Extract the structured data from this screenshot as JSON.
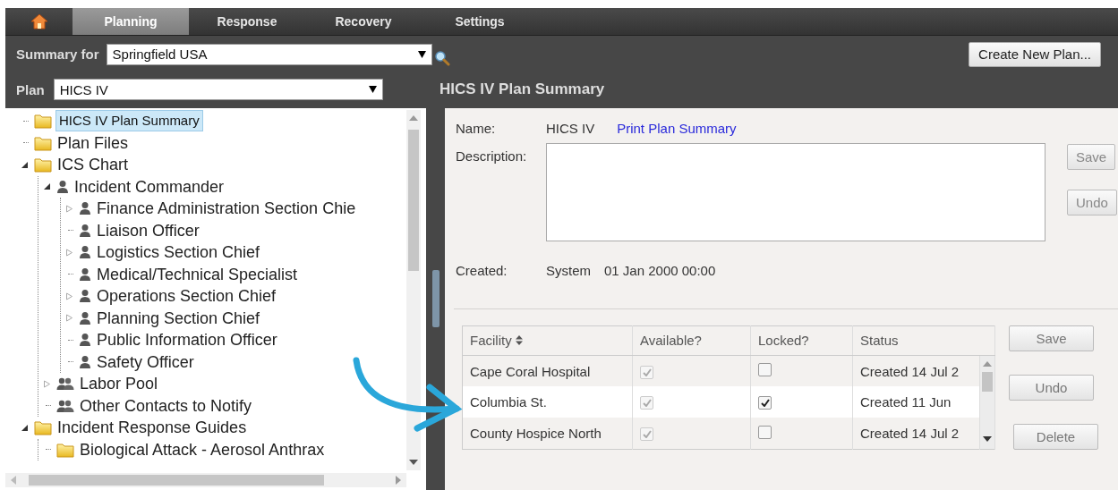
{
  "nav": {
    "tabs": [
      {
        "label": "Planning",
        "selected": true
      },
      {
        "label": "Response",
        "selected": false
      },
      {
        "label": "Recovery",
        "selected": false
      },
      {
        "label": "Settings",
        "selected": false
      }
    ]
  },
  "summary_for": {
    "label": "Summary for",
    "value": "Springfield USA"
  },
  "create_button": "Create New Plan...",
  "plan": {
    "label": "Plan",
    "value": "HICS IV"
  },
  "tree": {
    "items": [
      {
        "label": "HICS IV Plan Summary",
        "kind": "folder",
        "selected": true
      },
      {
        "label": "Plan Files",
        "kind": "folder",
        "selected": false
      },
      {
        "label": "ICS Chart",
        "kind": "folder",
        "selected": false,
        "expanded": true,
        "children": [
          {
            "label": "Incident Commander",
            "kind": "person",
            "selected": false,
            "expanded": true,
            "children": [
              {
                "label": "Finance Administration Section Chie",
                "kind": "person",
                "selected": false,
                "expanded": false
              },
              {
                "label": "Liaison Officer",
                "kind": "person",
                "selected": false
              },
              {
                "label": "Logistics Section Chief",
                "kind": "person",
                "selected": false,
                "expanded": false
              },
              {
                "label": "Medical/Technical Specialist",
                "kind": "person",
                "selected": false
              },
              {
                "label": "Operations Section Chief",
                "kind": "person",
                "selected": false,
                "expanded": false
              },
              {
                "label": "Planning Section Chief",
                "kind": "person",
                "selected": false,
                "expanded": false
              },
              {
                "label": "Public Information Officer",
                "kind": "person",
                "selected": false
              },
              {
                "label": "Safety Officer",
                "kind": "person",
                "selected": false
              }
            ]
          },
          {
            "label": "Labor Pool",
            "kind": "group",
            "selected": false,
            "expanded": false
          },
          {
            "label": "Other Contacts to Notify",
            "kind": "group",
            "selected": false
          }
        ]
      },
      {
        "label": "Incident Response Guides",
        "kind": "folder",
        "selected": false,
        "expanded": true,
        "children": [
          {
            "label": "Biological Attack - Aerosol Anthrax",
            "kind": "folder",
            "selected": false
          }
        ]
      }
    ]
  },
  "panel": {
    "title": "HICS IV Plan Summary",
    "name_label": "Name:",
    "name_value": "HICS IV",
    "print_link": "Print Plan Summary",
    "description_label": "Description:",
    "description_buttons": [
      "Save",
      "Undo"
    ],
    "created_label": "Created:",
    "created_by": "System",
    "created_date": "01 Jan 2000 00:00"
  },
  "facilities": {
    "columns": [
      {
        "label": "Facility",
        "sortable": true
      },
      {
        "label": "Available?",
        "sortable": false
      },
      {
        "label": "Locked?",
        "sortable": false
      },
      {
        "label": "Status",
        "sortable": false
      }
    ],
    "rows": [
      {
        "facility": "Cape Coral Hospital",
        "available": true,
        "locked": false,
        "status": "Created 14 Jul 2",
        "selected": false
      },
      {
        "facility": "Columbia St.",
        "available": true,
        "locked": true,
        "status": "Created 11 Jun",
        "selected": true
      },
      {
        "facility": "County Hospice North",
        "available": true,
        "locked": false,
        "status": "Created 14 Jul 2",
        "selected": false
      }
    ],
    "buttons": [
      "Save",
      "Undo",
      "Delete"
    ]
  }
}
